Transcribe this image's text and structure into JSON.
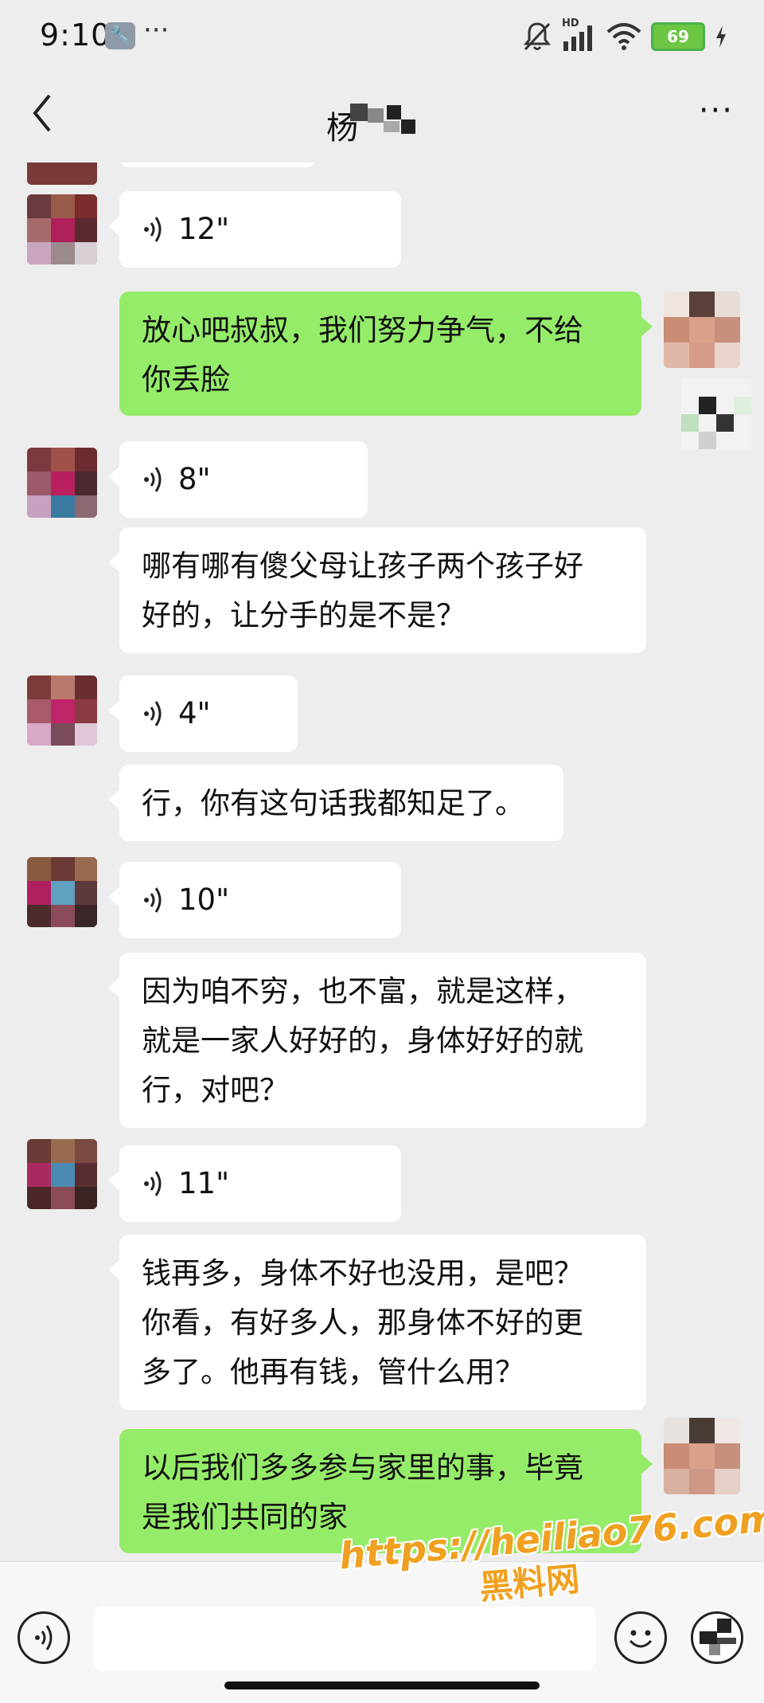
{
  "status_bar": {
    "time": "9:10",
    "tool_icon": "wrench-icon",
    "more": "···",
    "network": "HD",
    "battery": "69"
  },
  "header": {
    "title": "杨",
    "back_icon": "back-arrow-icon",
    "more": "···"
  },
  "messages": [
    {
      "side": "in",
      "type": "voice",
      "duration": "12\""
    },
    {
      "side": "out",
      "type": "text",
      "lines": [
        "放心吧叔叔，我们努力争气，不给",
        "你丢脸"
      ]
    },
    {
      "side": "in",
      "type": "voice",
      "duration": "8\""
    },
    {
      "side": "in",
      "type": "text",
      "lines": [
        "哪有哪有傻父母让孩子两个孩子好",
        "好的，让分手的是不是？"
      ]
    },
    {
      "side": "in",
      "type": "voice",
      "duration": "4\""
    },
    {
      "side": "in",
      "type": "text",
      "lines": [
        "行，你有这句话我都知足了。"
      ]
    },
    {
      "side": "in",
      "type": "voice",
      "duration": "10\""
    },
    {
      "side": "in",
      "type": "text",
      "lines": [
        "因为咱不穷，也不富，就是这样，",
        "就是一家人好好的，身体好好的就",
        "行，对吧？"
      ]
    },
    {
      "side": "in",
      "type": "voice",
      "duration": "11\""
    },
    {
      "side": "in",
      "type": "text",
      "lines": [
        "钱再多，身体不好也没用，是吧？",
        "你看，有好多人，那身体不好的更",
        "多了。他再有钱，管什么用？"
      ]
    },
    {
      "side": "out",
      "type": "text",
      "lines": [
        "以后我们多多参与家里的事，毕竟",
        "是我们共同的家"
      ]
    }
  ],
  "watermark": {
    "url": "https://heiliao76.com",
    "name": "黑料网"
  },
  "colors": {
    "background": "#ededed",
    "outgoing_bubble": "#95ec69",
    "incoming_bubble": "#ffffff",
    "watermark": "#f0a020"
  }
}
